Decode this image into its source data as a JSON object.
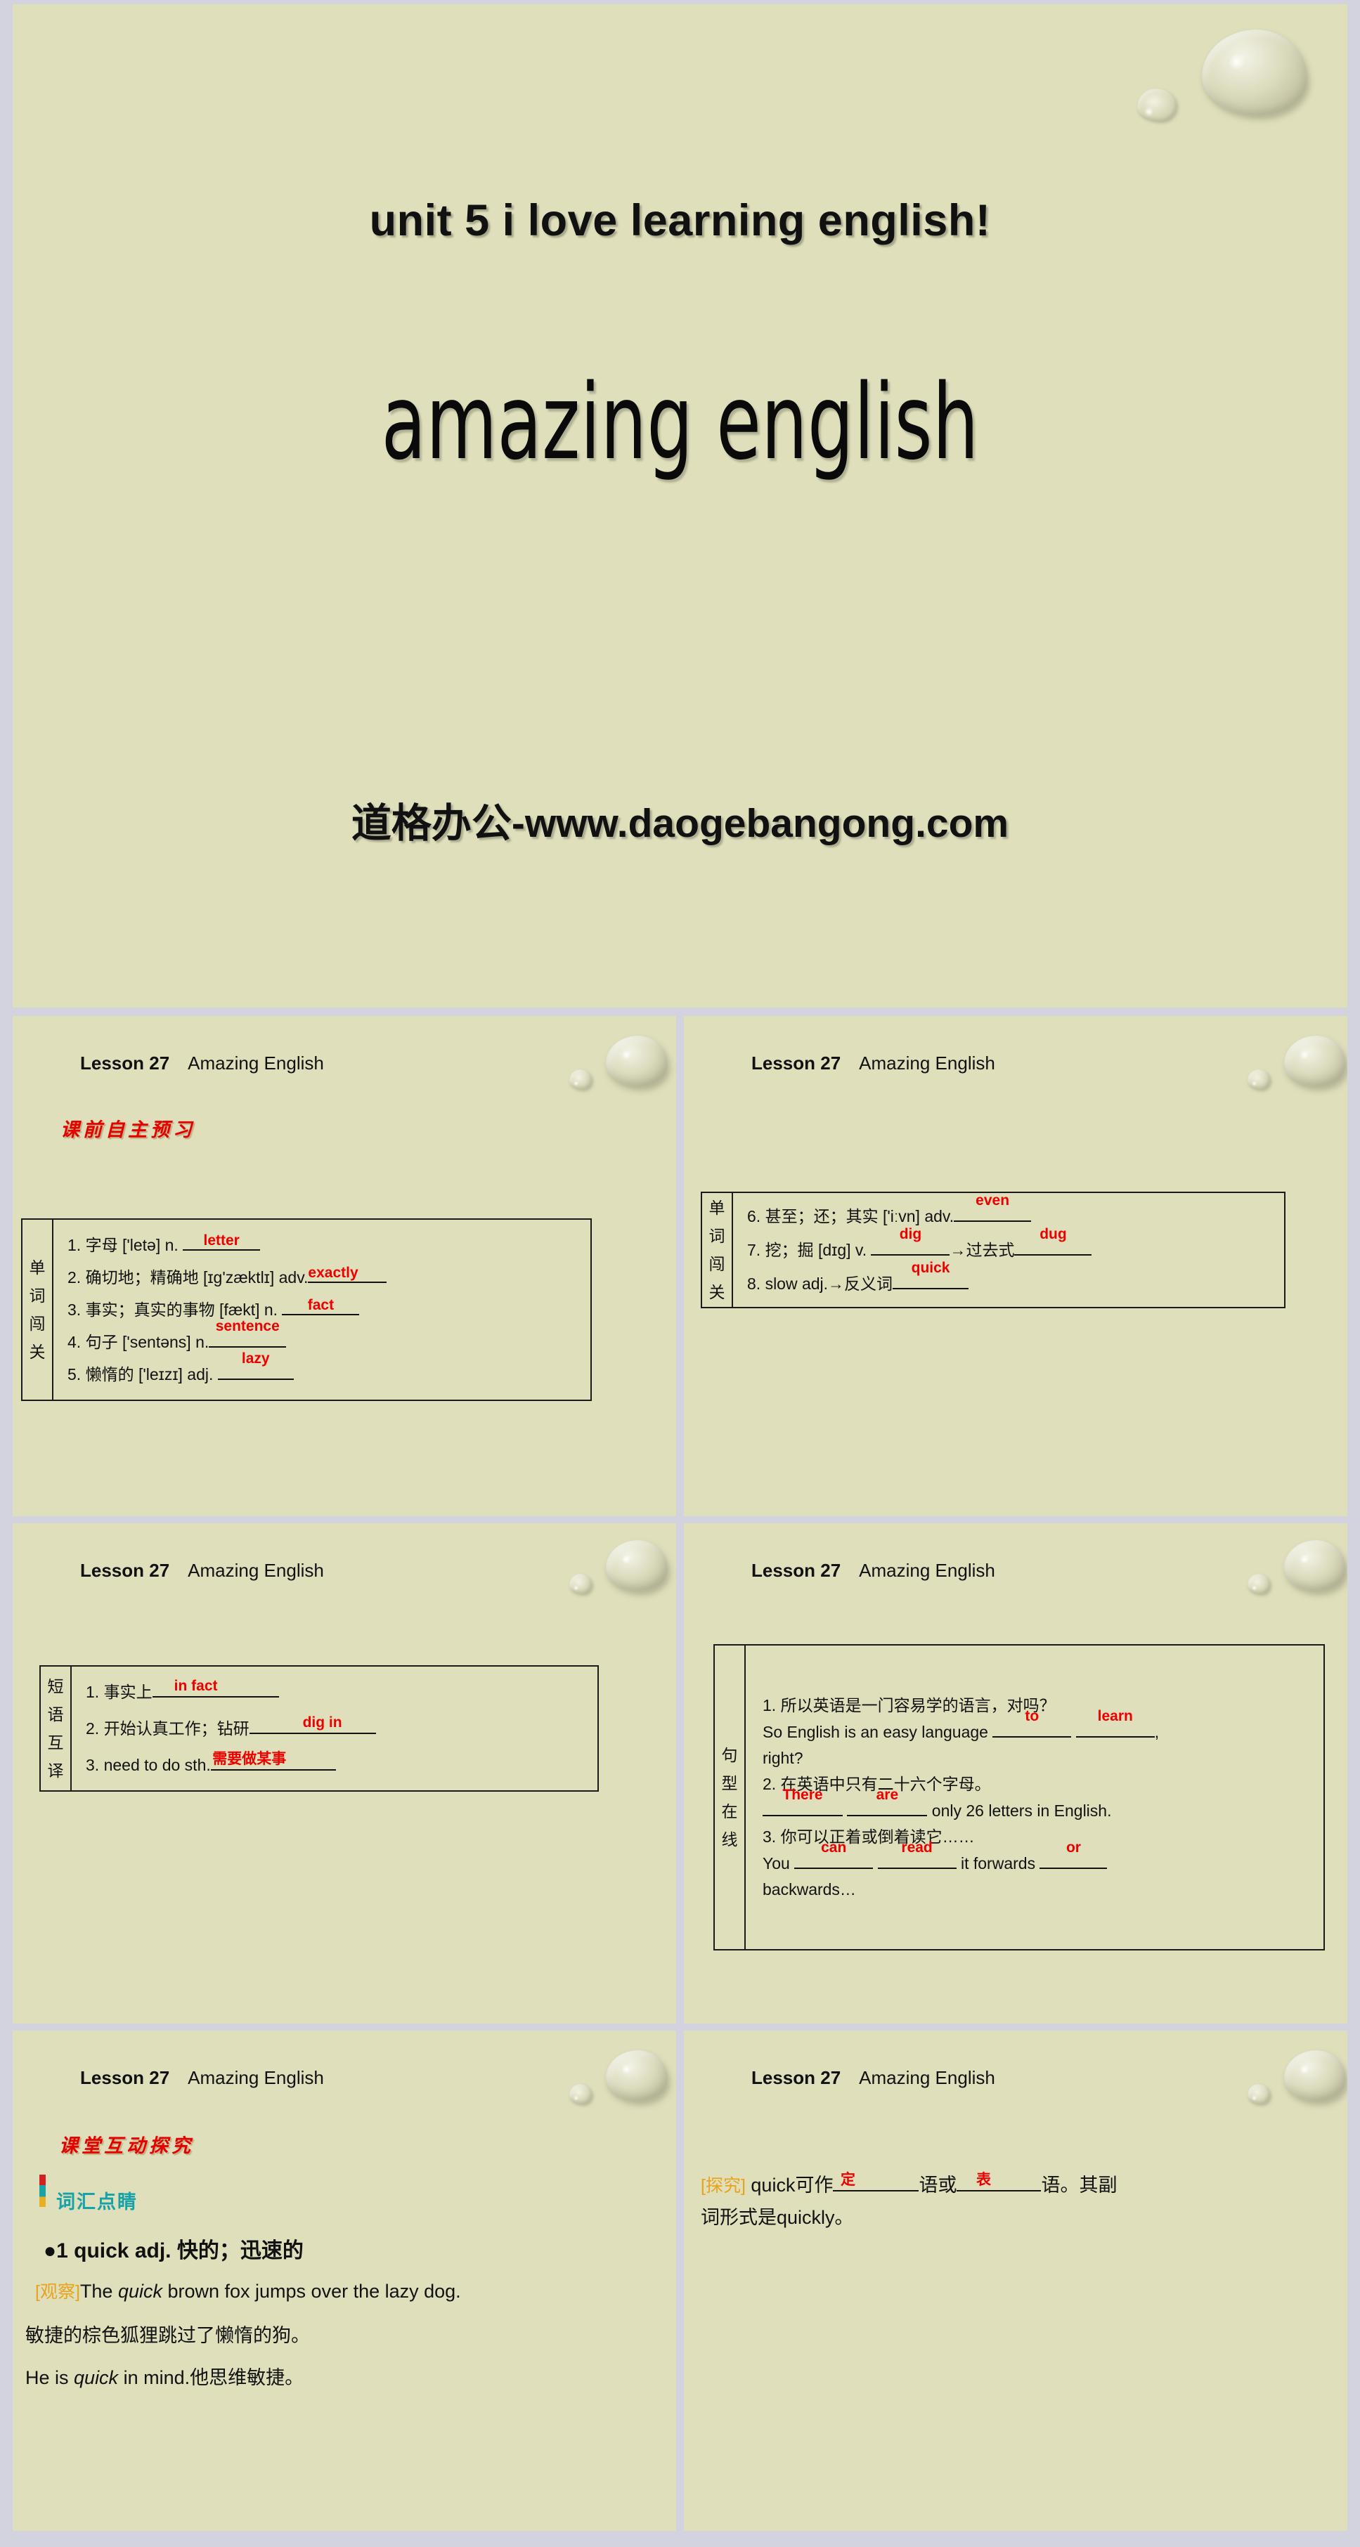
{
  "title_slide": {
    "unit_line": "unit 5   i love learning english!",
    "main_title": "amazing english",
    "watermark": "道格办公-www.daogebangong.com"
  },
  "slide_header": {
    "lesson": "Lesson 27",
    "topic": "Amazing English"
  },
  "colors": {
    "background": "#dfdfbc",
    "divider": "#d3d3e0",
    "answer_red": "#ee0000",
    "heading_red": "#e60000",
    "teal": "#17a2a8",
    "orange_tag": "#e8a31c"
  },
  "slides": [
    {
      "id": "s1",
      "red_heading": "课前自主预习",
      "side_label": "单词闯关",
      "rows": [
        {
          "prefix": "1.  字母 ['letə] n. ",
          "answers": [
            "letter"
          ],
          "blank_widths": [
            110
          ]
        },
        {
          "prefix": "2.  确切地；精确地 [ɪɡ'zæktlɪ] adv.",
          "answers": [
            "exactly"
          ],
          "blank_widths": [
            112
          ]
        },
        {
          "prefix": "3.  事实；真实的事物 [fækt] n. ",
          "answers": [
            "fact"
          ],
          "blank_widths": [
            110
          ]
        },
        {
          "prefix": "4.  句子 ['sentəns] n.",
          "answers": [
            "sentence"
          ],
          "blank_widths": [
            110
          ]
        },
        {
          "prefix": "5.  懒惰的 ['leɪzɪ] adj. ",
          "answers": [
            "lazy"
          ],
          "blank_widths": [
            108
          ]
        }
      ]
    },
    {
      "id": "s2",
      "side_label": "单词闯关",
      "rows": [
        {
          "prefix": "6.  甚至；还；其实 ['iːvn] adv.",
          "answers": [
            "even"
          ],
          "blank_widths": [
            110
          ]
        },
        {
          "prefix": "7.  挖；掘 [dɪɡ] v. ",
          "mid": "→过去式",
          "answers": [
            "dig",
            "dug"
          ],
          "blank_widths": [
            112,
            110
          ]
        },
        {
          "prefix": "8.  slow adj.→反义词",
          "answers": [
            "quick"
          ],
          "blank_widths": [
            108
          ]
        }
      ]
    },
    {
      "id": "s3",
      "side_label": "短语互译",
      "rows": [
        {
          "prefix": "1.  事实上",
          "answers": [
            "in fact"
          ],
          "blank_widths": [
            180
          ]
        },
        {
          "prefix": "2.  开始认真工作；钻研",
          "answers": [
            "dig in"
          ],
          "blank_widths": [
            180
          ]
        },
        {
          "prefix": "3.  need to do sth.",
          "answers": [
            "需要做某事"
          ],
          "blank_widths": [
            178
          ]
        }
      ]
    },
    {
      "id": "s4",
      "side_label": "句型在线",
      "lines": [
        {
          "type": "plain",
          "text": "1.  所以英语是一门容易学的语言，对吗？"
        },
        {
          "type": "fill",
          "prefix": "So English is an easy language ",
          "answers": [
            "to",
            "learn"
          ],
          "blank_widths": [
            112,
            112
          ],
          "suffix": ","
        },
        {
          "type": "plain",
          "text": "right?"
        },
        {
          "type": "plain",
          "text": "2.  在英语中只有二十六个字母。"
        },
        {
          "type": "fill",
          "prefix": "",
          "answers": [
            "There",
            "are"
          ],
          "blank_widths": [
            114,
            114
          ],
          "suffix": " only 26 letters in English."
        },
        {
          "type": "plain",
          "text": "3.  你可以正着或倒着读它……"
        },
        {
          "type": "fill",
          "prefix": "You ",
          "answers": [
            "can",
            "read"
          ],
          "mid": " it forwards ",
          "answers3": [
            "or"
          ],
          "blank_widths": [
            112,
            112,
            96
          ]
        },
        {
          "type": "plain",
          "text": "backwards…"
        }
      ]
    },
    {
      "id": "s5",
      "red_heading": "课堂互动探究",
      "flag_label": "词汇点睛",
      "bullet": "●1    quick adj. 快的；迅速的",
      "observe_tag": "[观察]",
      "observe_line_a1": "The ",
      "observe_line_a2": "quick",
      "observe_line_a3": " brown fox jumps over the lazy dog.",
      "observe_line_b": "敏捷的棕色狐狸跳过了懒惰的狗。",
      "observe_line_c1": "He is ",
      "observe_line_c2": "quick",
      "observe_line_c3": " in mind.他思维敏捷。"
    },
    {
      "id": "s6",
      "explore_tag": "[探究]",
      "explore_a": " quick可作",
      "explore_ans1": "定",
      "explore_b": "语或",
      "explore_ans2": "表",
      "explore_c": "语。其副",
      "explore_d": "词形式是quickly。"
    }
  ]
}
